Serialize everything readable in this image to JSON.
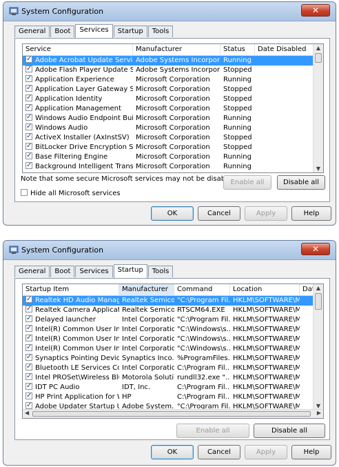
{
  "window1": {
    "title": "System Configuration",
    "tabs": [
      "General",
      "Boot",
      "Services",
      "Startup",
      "Tools"
    ],
    "columns": [
      "Service",
      "Manufacturer",
      "Status",
      "Date Disabled"
    ],
    "rows": [
      {
        "service": "Adobe Acrobat Update Service",
        "manufacturer": "Adobe Systems Incorporated",
        "status": "Running",
        "date": ""
      },
      {
        "service": "Adobe Flash Player Update Service",
        "manufacturer": "Adobe Systems Incorporated",
        "status": "Stopped",
        "date": ""
      },
      {
        "service": "Application Experience",
        "manufacturer": "Microsoft Corporation",
        "status": "Running",
        "date": ""
      },
      {
        "service": "Application Layer Gateway Service",
        "manufacturer": "Microsoft Corporation",
        "status": "Stopped",
        "date": ""
      },
      {
        "service": "Application Identity",
        "manufacturer": "Microsoft Corporation",
        "status": "Stopped",
        "date": ""
      },
      {
        "service": "Application Management",
        "manufacturer": "Microsoft Corporation",
        "status": "Stopped",
        "date": ""
      },
      {
        "service": "Windows Audio Endpoint Builder",
        "manufacturer": "Microsoft Corporation",
        "status": "Running",
        "date": ""
      },
      {
        "service": "Windows Audio",
        "manufacturer": "Microsoft Corporation",
        "status": "Running",
        "date": ""
      },
      {
        "service": "ActiveX Installer (AxInstSV)",
        "manufacturer": "Microsoft Corporation",
        "status": "Stopped",
        "date": ""
      },
      {
        "service": "BitLocker Drive Encryption Service",
        "manufacturer": "Microsoft Corporation",
        "status": "Stopped",
        "date": ""
      },
      {
        "service": "Base Filtering Engine",
        "manufacturer": "Microsoft Corporation",
        "status": "Running",
        "date": ""
      },
      {
        "service": "Background Intelligent Transfer ...",
        "manufacturer": "Microsoft Corporation",
        "status": "Running",
        "date": ""
      }
    ],
    "note": "Note that some secure Microsoft services may not be disabled.",
    "enable_all": "Enable all",
    "disable_all": "Disable all",
    "hide_ms": "Hide all Microsoft services",
    "ok": "OK",
    "cancel": "Cancel",
    "apply": "Apply",
    "help": "Help"
  },
  "window2": {
    "title": "System Configuration",
    "tabs": [
      "General",
      "Boot",
      "Services",
      "Startup",
      "Tools"
    ],
    "columns": [
      "Startup Item",
      "Manufacturer",
      "Command",
      "Location",
      "Date"
    ],
    "rows": [
      {
        "item": "Realtek HD Audio Manager",
        "manufacturer": "Realtek Semico...",
        "command": "\"C:\\Program Fil...",
        "location": "HKLM\\SOFTWARE\\M..."
      },
      {
        "item": "Realtek Camera Application",
        "manufacturer": "Realtek Semico...",
        "command": "RTSCM64.EXE",
        "location": "HKLM\\SOFTWARE\\M..."
      },
      {
        "item": "Delayed launcher",
        "manufacturer": "Intel Corporation",
        "command": "\"C:\\Program Fil...",
        "location": "HKLM\\SOFTWARE\\M..."
      },
      {
        "item": "Intel(R) Common User Inter...",
        "manufacturer": "Intel Corporation",
        "command": "\"C:\\Windows\\s...",
        "location": "HKLM\\SOFTWARE\\M..."
      },
      {
        "item": "Intel(R) Common User Inter...",
        "manufacturer": "Intel Corporation",
        "command": "\"C:\\Windows\\s...",
        "location": "HKLM\\SOFTWARE\\M..."
      },
      {
        "item": "Intel(R) Common User Inter...",
        "manufacturer": "Intel Corporation",
        "command": "\"C:\\Windows\\s...",
        "location": "HKLM\\SOFTWARE\\M..."
      },
      {
        "item": "Synaptics Pointing Device D...",
        "manufacturer": "Synaptics Inco...",
        "command": "%ProgramFiles...",
        "location": "HKLM\\SOFTWARE\\M..."
      },
      {
        "item": "Bluetooth LE Services Contr...",
        "manufacturer": "Intel Corporation",
        "command": "C:\\Program Fil...",
        "location": "HKLM\\SOFTWARE\\M..."
      },
      {
        "item": "Intel PROSet\\Wireless Bluet...",
        "manufacturer": "Motorola Soluti...",
        "command": "rundll32.exe \"...",
        "location": "HKLM\\SOFTWARE\\M..."
      },
      {
        "item": "IDT PC Audio",
        "manufacturer": "IDT, Inc.",
        "command": "C:\\Program Fil...",
        "location": "HKLM\\SOFTWARE\\M..."
      },
      {
        "item": "HP Print Application for Win...",
        "manufacturer": "HP",
        "command": "C:\\Program Fil...",
        "location": "HKLM\\SOFTWARE\\M..."
      },
      {
        "item": "Adobe Updater Startup Utility",
        "manufacturer": "Adobe System...",
        "command": "\"C:\\Program Fil...",
        "location": "HKLM\\SOFTWARE\\M..."
      }
    ],
    "enable_all": "Enable all",
    "disable_all": "Disable all",
    "ok": "OK",
    "cancel": "Cancel",
    "apply": "Apply",
    "help": "Help"
  }
}
